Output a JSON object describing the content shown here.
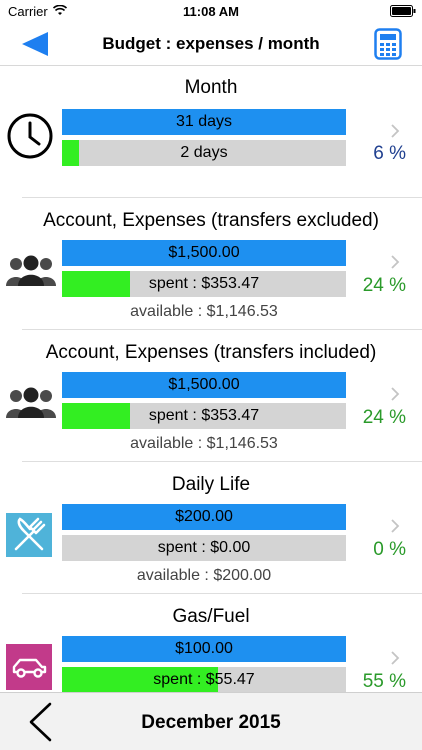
{
  "status_bar": {
    "carrier": "Carrier",
    "time": "11:08 AM"
  },
  "nav": {
    "title": "Budget : expenses / month",
    "back_icon": "back-triangle-icon",
    "calculator_icon": "calculator-icon"
  },
  "sections": [
    {
      "title": "Month",
      "icon": "clock-icon",
      "top_value": "31 days",
      "bottom_value": "2 days",
      "progress": 0.06,
      "percent": "6 %",
      "percent_color": "#1f3f8f",
      "available": null
    },
    {
      "title": "Account, Expenses (transfers excluded)",
      "icon": "people-group-icon",
      "top_value": "$1,500.00",
      "bottom_value": "spent : $353.47",
      "progress": 0.24,
      "percent": "24 %",
      "percent_color": "#2a9a2a",
      "available": "available : $1,146.53"
    },
    {
      "title": "Account, Expenses (transfers included)",
      "icon": "people-group-icon",
      "top_value": "$1,500.00",
      "bottom_value": "spent : $353.47",
      "progress": 0.24,
      "percent": "24 %",
      "percent_color": "#2a9a2a",
      "available": "available : $1,146.53"
    },
    {
      "title": "Daily Life",
      "icon": "fork-knife-icon",
      "top_value": "$200.00",
      "bottom_value": "spent : $0.00",
      "progress": 0.0,
      "percent": "0 %",
      "percent_color": "#2a9a2a",
      "available": "available : $200.00"
    },
    {
      "title": "Gas/Fuel",
      "icon": "car-icon",
      "top_value": "$100.00",
      "bottom_value": "spent : $55.47",
      "progress": 0.55,
      "percent": "55 %",
      "percent_color": "#2a9a2a",
      "available": null
    }
  ],
  "bottom_bar": {
    "month": "December 2015",
    "prev_icon": "chevron-left-icon"
  },
  "colors": {
    "accent_blue": "#1e90f0",
    "progress_green": "#33ee22",
    "track_gray": "#d4d4d4"
  }
}
